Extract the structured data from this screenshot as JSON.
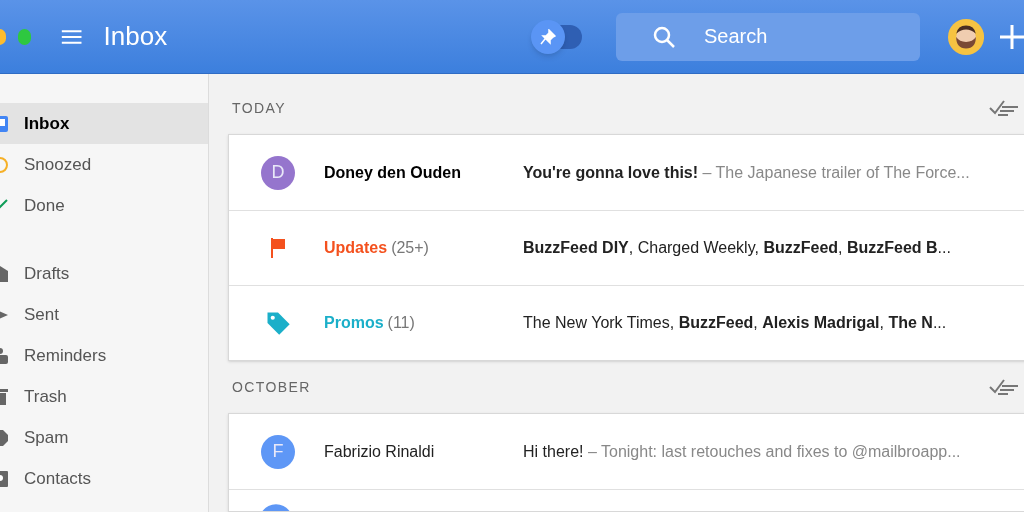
{
  "window": {
    "title": "Inbox"
  },
  "pin_toggle": {
    "on": false
  },
  "search": {
    "placeholder": "Search"
  },
  "sidebar": {
    "groups": [
      {
        "items": [
          {
            "label": "Inbox",
            "selected": true
          },
          {
            "label": "Snoozed",
            "selected": false
          },
          {
            "label": "Done",
            "selected": false
          }
        ]
      },
      {
        "items": [
          {
            "label": "Drafts",
            "selected": false
          },
          {
            "label": "Sent",
            "selected": false
          },
          {
            "label": "Reminders",
            "selected": false
          },
          {
            "label": "Trash",
            "selected": false
          },
          {
            "label": "Spam",
            "selected": false
          },
          {
            "label": "Contacts",
            "selected": false
          }
        ]
      }
    ]
  },
  "sections": [
    {
      "title": "TODAY",
      "rows": [
        {
          "kind": "person",
          "letter": "D",
          "color": "#9575cd",
          "name": "Doney den Ouden",
          "unread": true,
          "subject": "You're gonna love this!",
          "snippet": "– The Japanese trailer of The Force..."
        },
        {
          "kind": "flag",
          "color": "#f4511e",
          "name": "Updates",
          "count": "(25+)",
          "senders": "**BuzzFeed DIY**, Charged Weekly, **BuzzFeed**, **BuzzFeed B**..."
        },
        {
          "kind": "tag",
          "color": "#1bafc9",
          "name": "Promos",
          "count": "(11)",
          "senders": "The New York Times, **BuzzFeed**, **Alexis Madrigal**, **The N**..."
        }
      ]
    },
    {
      "title": "OCTOBER",
      "rows": [
        {
          "kind": "person",
          "letter": "F",
          "color": "#5e97f6",
          "name": "Fabrizio Rinaldi",
          "unread": false,
          "subject": "Hi there!",
          "snippet": "– Tonight: last retouches and fixes to @mailbroapp..."
        },
        {
          "kind": "stub",
          "color": "#5e97f6"
        }
      ]
    }
  ]
}
